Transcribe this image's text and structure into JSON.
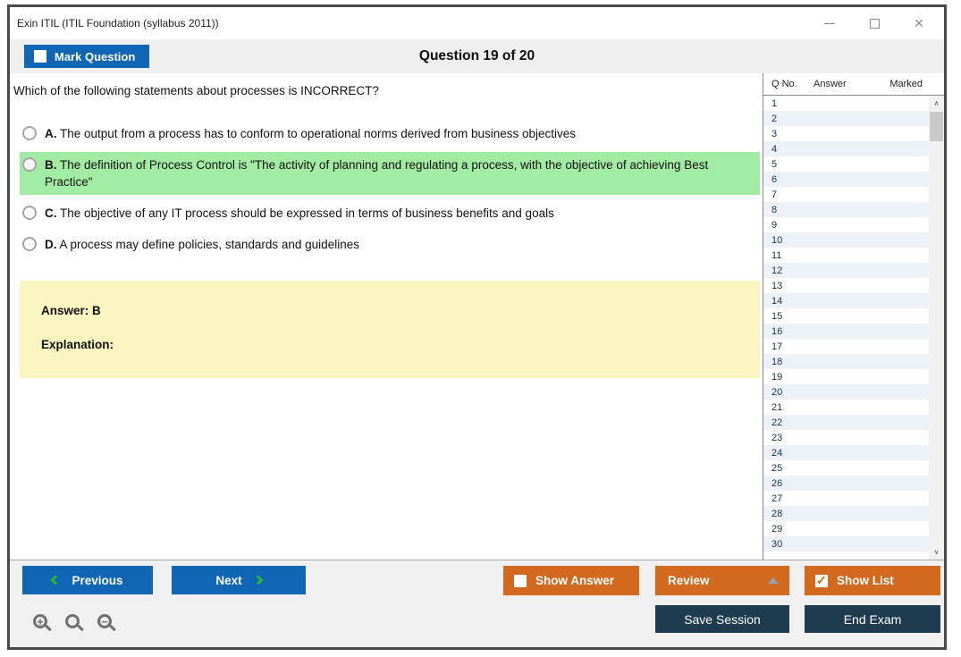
{
  "window": {
    "title": "Exin ITIL (ITIL Foundation (syllabus 2011))"
  },
  "header": {
    "mark_question_label": "Mark Question",
    "question_counter": "Question 19 of 20"
  },
  "question": {
    "text": "Which of the following statements about processes is INCORRECT?",
    "options": [
      {
        "letter": "A.",
        "text": "The output from a process has to conform to operational norms derived from business objectives",
        "highlighted": false
      },
      {
        "letter": "B.",
        "text": "The definition of Process Control is \"The activity of planning and regulating a process, with the objective of achieving Best Practice\"",
        "highlighted": true
      },
      {
        "letter": "C.",
        "text": "The objective of any IT process should be expressed in terms of business benefits and goals",
        "highlighted": false
      },
      {
        "letter": "D.",
        "text": "A process may define policies, standards and guidelines",
        "highlighted": false
      }
    ],
    "answer_label": "Answer: B",
    "explanation_label": "Explanation:"
  },
  "question_list": {
    "columns": [
      "Q No.",
      "Answer",
      "Marked"
    ],
    "rows": [
      {
        "q": "1",
        "answer": "",
        "marked": ""
      },
      {
        "q": "2",
        "answer": "",
        "marked": ""
      },
      {
        "q": "3",
        "answer": "",
        "marked": ""
      },
      {
        "q": "4",
        "answer": "",
        "marked": ""
      },
      {
        "q": "5",
        "answer": "",
        "marked": ""
      },
      {
        "q": "6",
        "answer": "",
        "marked": ""
      },
      {
        "q": "7",
        "answer": "",
        "marked": ""
      },
      {
        "q": "8",
        "answer": "",
        "marked": ""
      },
      {
        "q": "9",
        "answer": "",
        "marked": ""
      },
      {
        "q": "10",
        "answer": "",
        "marked": ""
      },
      {
        "q": "11",
        "answer": "",
        "marked": ""
      },
      {
        "q": "12",
        "answer": "",
        "marked": ""
      },
      {
        "q": "13",
        "answer": "",
        "marked": ""
      },
      {
        "q": "14",
        "answer": "",
        "marked": ""
      },
      {
        "q": "15",
        "answer": "",
        "marked": ""
      },
      {
        "q": "16",
        "answer": "",
        "marked": ""
      },
      {
        "q": "17",
        "answer": "",
        "marked": ""
      },
      {
        "q": "18",
        "answer": "",
        "marked": ""
      },
      {
        "q": "19",
        "answer": "",
        "marked": ""
      },
      {
        "q": "20",
        "answer": "",
        "marked": ""
      },
      {
        "q": "21",
        "answer": "",
        "marked": ""
      },
      {
        "q": "22",
        "answer": "",
        "marked": ""
      },
      {
        "q": "23",
        "answer": "",
        "marked": ""
      },
      {
        "q": "24",
        "answer": "",
        "marked": ""
      },
      {
        "q": "25",
        "answer": "",
        "marked": ""
      },
      {
        "q": "26",
        "answer": "",
        "marked": ""
      },
      {
        "q": "27",
        "answer": "",
        "marked": ""
      },
      {
        "q": "28",
        "answer": "",
        "marked": ""
      },
      {
        "q": "29",
        "answer": "",
        "marked": ""
      },
      {
        "q": "30",
        "answer": "",
        "marked": ""
      }
    ]
  },
  "footer": {
    "previous_label": "Previous",
    "next_label": "Next",
    "show_answer_label": "Show Answer",
    "review_label": "Review",
    "show_list_label": "Show List",
    "save_session_label": "Save Session",
    "end_exam_label": "End Exam"
  },
  "checkboxes": {
    "mark_question": false,
    "show_answer": false,
    "show_list": true
  },
  "colors": {
    "accent_blue": "#1065b5",
    "accent_orange": "#d2691e",
    "dark_navy": "#1e3b50",
    "highlight_green": "#a2eba2",
    "answer_yellow": "#faf4be",
    "row_alt_blue": "#edf2f9",
    "chevron_green": "#2db52d"
  }
}
